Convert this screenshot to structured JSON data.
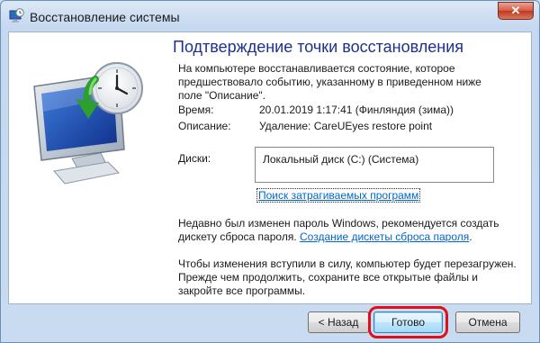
{
  "window": {
    "title": "Восстановление системы",
    "close_label": "✕"
  },
  "main": {
    "heading": "Подтверждение точки восстановления",
    "intro": "На компьютере восстанавливается состояние, которое предшествовало событию, указанному в приведенном ниже поле \"Описание\".",
    "time_label": "Время:",
    "time_value": "20.01.2019 1:17:41 (Финляндия (зима))",
    "description_label": "Описание:",
    "description_value": "Удаление: CareUEyes restore point",
    "disks_label": "Диски:",
    "disks_value": "Локальный диск (C:) (Система)",
    "affected_programs_link": "Поиск затрагиваемых программ",
    "password_note": "Недавно был изменен пароль Windows, рекомендуется создать дискету сброса пароля.",
    "password_link": "Создание дискеты сброса пароля",
    "password_note_end": ".",
    "restart_note": "Чтобы изменения вступили в силу, компьютер будет перезагружен. Прежде чем продолжить, сохраните все открытые файлы и закройте все программы."
  },
  "footer": {
    "back_label": "< Назад",
    "finish_label": "Готово",
    "cancel_label": "Отмена"
  },
  "icons": {
    "app": "system-restore-icon",
    "hero": "monitor-clock-restore-icon"
  },
  "colors": {
    "heading": "#1e3287",
    "link": "#0066cc",
    "highlight": "#e0101a",
    "close": "#c0381f"
  }
}
